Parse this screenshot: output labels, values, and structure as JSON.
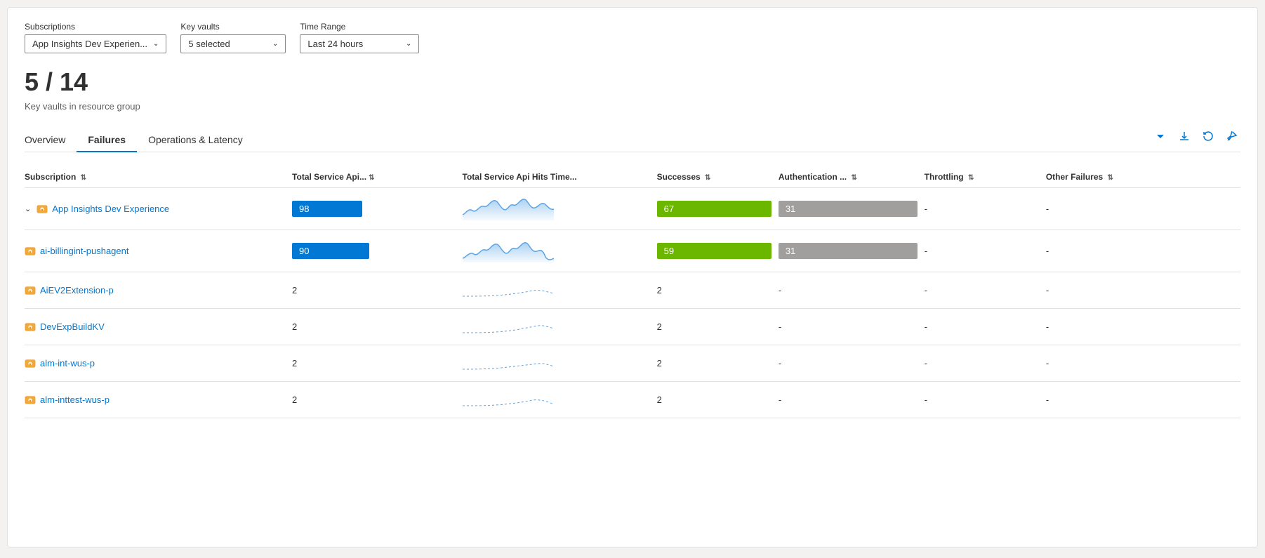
{
  "filters": {
    "subscriptions_label": "Subscriptions",
    "subscriptions_value": "App Insights Dev Experien...",
    "keyvaults_label": "Key vaults",
    "keyvaults_value": "5 selected",
    "timerange_label": "Time Range",
    "timerange_value": "Last 24 hours"
  },
  "summary": {
    "count": "5 / 14",
    "description": "Key vaults in resource group"
  },
  "tabs": [
    {
      "id": "overview",
      "label": "Overview"
    },
    {
      "id": "failures",
      "label": "Failures"
    },
    {
      "id": "operations-latency",
      "label": "Operations & Latency"
    }
  ],
  "active_tab": "failures",
  "table": {
    "columns": [
      {
        "id": "subscription",
        "label": "Subscription"
      },
      {
        "id": "total-api",
        "label": "Total Service Api..."
      },
      {
        "id": "timechart",
        "label": "Total Service Api Hits Time..."
      },
      {
        "id": "successes",
        "label": "Successes"
      },
      {
        "id": "auth",
        "label": "Authentication ..."
      },
      {
        "id": "throttling",
        "label": "Throttling"
      },
      {
        "id": "other-failures",
        "label": "Other Failures"
      }
    ],
    "rows": [
      {
        "id": "app-insights",
        "name": "App Insights Dev Experience",
        "indent": false,
        "collapsed": true,
        "total_api": "98",
        "total_api_bar": true,
        "total_api_bar_type": "blue-lg",
        "successes": "67",
        "successes_bar": true,
        "successes_bar_type": "green",
        "auth": "31",
        "auth_bar": true,
        "auth_bar_type": "gray",
        "throttling": "-",
        "other_failures": "-"
      },
      {
        "id": "ai-billingint",
        "name": "ai-billingint-pushagent",
        "indent": true,
        "collapsed": false,
        "total_api": "90",
        "total_api_bar": true,
        "total_api_bar_type": "blue-sm",
        "successes": "59",
        "successes_bar": true,
        "successes_bar_type": "green",
        "auth": "31",
        "auth_bar": true,
        "auth_bar_type": "gray",
        "throttling": "-",
        "other_failures": "-"
      },
      {
        "id": "aiev2extension",
        "name": "AiEV2Extension-p",
        "indent": true,
        "collapsed": false,
        "total_api": "2",
        "total_api_bar": false,
        "successes": "2",
        "successes_bar": false,
        "auth": "-",
        "auth_bar": false,
        "throttling": "-",
        "other_failures": "-"
      },
      {
        "id": "devexpbuildkv",
        "name": "DevExpBuildKV",
        "indent": true,
        "collapsed": false,
        "total_api": "2",
        "total_api_bar": false,
        "successes": "2",
        "successes_bar": false,
        "auth": "-",
        "auth_bar": false,
        "throttling": "-",
        "other_failures": "-"
      },
      {
        "id": "alm-int-wus-p",
        "name": "alm-int-wus-p",
        "indent": true,
        "collapsed": false,
        "total_api": "2",
        "total_api_bar": false,
        "successes": "2",
        "successes_bar": false,
        "auth": "-",
        "auth_bar": false,
        "throttling": "-",
        "other_failures": "-"
      },
      {
        "id": "alm-inttest-wus-p",
        "name": "alm-inttest-wus-p",
        "indent": true,
        "collapsed": false,
        "total_api": "2",
        "total_api_bar": false,
        "successes": "2",
        "successes_bar": false,
        "auth": "-",
        "auth_bar": false,
        "throttling": "-",
        "other_failures": "-"
      }
    ]
  },
  "actions": {
    "expand": "∨",
    "download": "↓",
    "refresh": "↺",
    "pin": "📌"
  }
}
